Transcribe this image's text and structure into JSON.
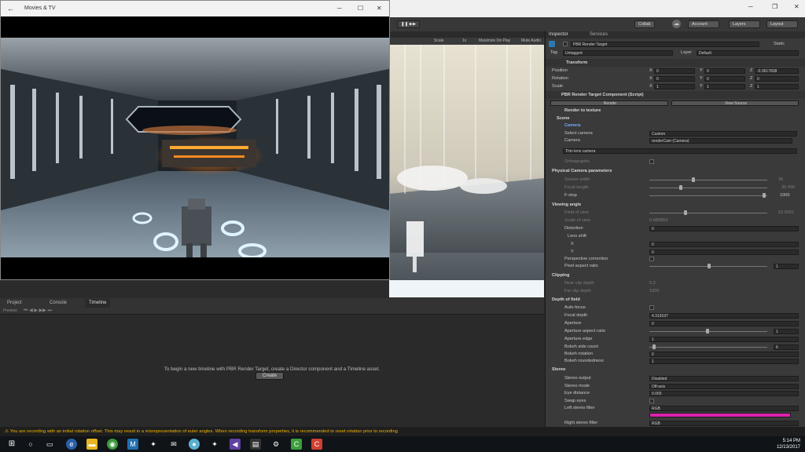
{
  "movies_app": {
    "title": "Movies & TV"
  },
  "toolbar": {
    "collab": "Collab",
    "account": "Account",
    "layers": "Layers",
    "layout": "Layout",
    "play_controls": "❚❚ ▶▶"
  },
  "scene_bar": {
    "scale_label": "Scale",
    "scale_value": "1x",
    "maximize": "Maximize On Play",
    "mute": "Mute Audio"
  },
  "inspector": {
    "tabs": [
      "Inspector",
      "Services"
    ],
    "object_name": "PBR Render Target",
    "static_label": "Static",
    "tag_label": "Tag",
    "tag_value": "Untagged",
    "layer_label": "Layer",
    "layer_value": "Default",
    "transform": {
      "header": "Transform",
      "position_label": "Position",
      "rotation_label": "Rotation",
      "scale_label": "Scale",
      "position": {
        "x": "0",
        "y": "0",
        "z": "-0.3617838"
      },
      "rotation": {
        "x": "0",
        "y": "0",
        "z": "0"
      },
      "scale": {
        "x": "1",
        "y": "1",
        "z": "1"
      }
    },
    "component": {
      "header": "PBR Render Target Component (Script)",
      "render_btn": "Render",
      "view_source_btn": "View Source",
      "render_to_texture": "Render to texture",
      "scene": "Scene",
      "camera_section": "Camera",
      "select_camera_label": "Select camera",
      "select_camera_value": "Custom",
      "camera_label": "Camera",
      "camera_value": "renderCam (Camera)",
      "thin_lens": "Thin lens camera",
      "orthographic": "Orthographic",
      "physical_header": "Physical Camera parameters",
      "sensor_width": "Sensor width",
      "sensor_width_val": "36",
      "focal_length": "Focal length",
      "focal_length_val": "36.496",
      "fstop": "F-stop",
      "fstop_val": "1000",
      "viewing_header": "Viewing angle",
      "field_of_view": "Field of view",
      "field_of_view_val": "52.5061",
      "scale_of_view": "Scale of view",
      "scale_of_view_val": "0.986853",
      "distortion": "Distortion",
      "distortion_val": "0",
      "lens_shift": "Lens shift",
      "shift_x_label": "X",
      "shift_x": "0",
      "shift_y_label": "Y",
      "shift_y": "0",
      "perspective": "Perspective correction",
      "pixel_aspect": "Pixel aspect ratio",
      "pixel_aspect_val": "1",
      "clipping_header": "Clipping",
      "near_clip": "Near clip depth",
      "near_clip_val": "0.3",
      "far_clip": "Far clip depth",
      "far_clip_val": "1000",
      "dof_header": "Depth of field",
      "auto_focus": "Auto-focus",
      "focal_depth": "Focal depth",
      "focal_depth_val": "4.319197",
      "aperture": "Aperture",
      "aperture_val": "0",
      "aperture_aspect": "Aperture aspect ratio",
      "aperture_aspect_val": "1",
      "aperture_edge": "Aperture edge",
      "aperture_edge_val": "1",
      "bokeh_side": "Bokeh side count",
      "bokeh_side_val": "6",
      "bokeh_rotation": "Bokeh rotation",
      "bokeh_rotation_val": "0",
      "bokeh_roundedness": "Bokeh roundedness",
      "bokeh_roundedness_val": "1",
      "stereo_header": "Stereo",
      "stereo_output": "Stereo output",
      "stereo_output_val": "Disabled",
      "stereo_mode": "Stereo mode",
      "stereo_mode_val": "Off-axis",
      "eye_distance": "Eye distance",
      "eye_distance_val": "0.065",
      "swap_eyes": "Swap eyes",
      "left_filter": "Left stereo filter",
      "left_filter_val": "RGB",
      "right_filter": "Right stereo filter",
      "right_filter_val": "RGB",
      "left_filter_color": "#e020b0"
    }
  },
  "bottom": {
    "tabs": [
      "Project",
      "Console",
      "Timeline"
    ],
    "preview": "Preview",
    "message": "To begin a new timeline with PBR Render Target, create a Director component and a Timeline asset.",
    "create_btn": "Create"
  },
  "status_warning": "⚠ You are recording with an initial rotation offset. This may result in a misrepresentation of euler angles. When recording transform properties, it is recommended to reset rotation prior to recording",
  "taskbar": {
    "time": "5:14 PM",
    "date": "12/13/2017"
  }
}
